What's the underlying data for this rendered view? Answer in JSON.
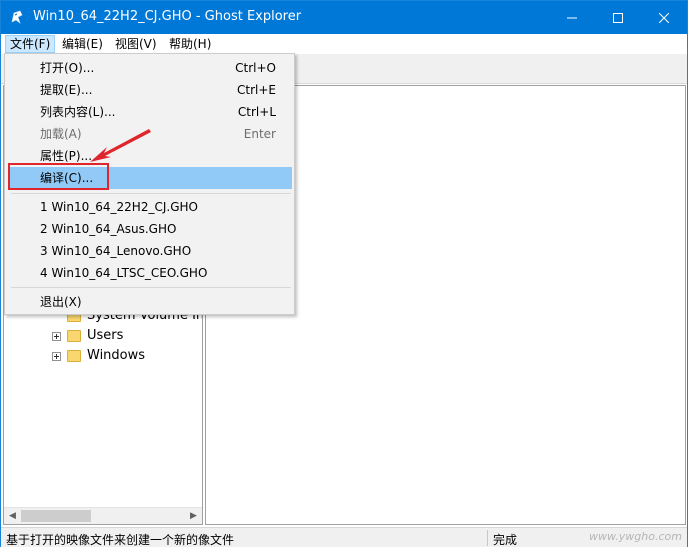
{
  "window": {
    "title": "Win10_64_22H2_CJ.GHO - Ghost Explorer",
    "icon": "ghost-app-icon"
  },
  "menubar": {
    "items": [
      {
        "label": "文件(F)"
      },
      {
        "label": "编辑(E)"
      },
      {
        "label": "视图(V)"
      },
      {
        "label": "帮助(H)"
      }
    ]
  },
  "file_menu": {
    "items": [
      {
        "label": "打开(O)...",
        "shortcut": "Ctrl+O"
      },
      {
        "label": "提取(E)...",
        "shortcut": "Ctrl+E"
      },
      {
        "label": "列表内容(L)...",
        "shortcut": "Ctrl+L"
      },
      {
        "label": "加载(A)",
        "shortcut": "Enter",
        "disabled": true
      },
      {
        "label": "属性(P)...",
        "shortcut": ""
      },
      {
        "label": "编译(C)...",
        "shortcut": "",
        "highlighted": true
      }
    ],
    "recent": [
      {
        "label": "1 Win10_64_22H2_CJ.GHO"
      },
      {
        "label": "2 Win10_64_Asus.GHO"
      },
      {
        "label": "3 Win10_64_Lenovo.GHO"
      },
      {
        "label": "4 Win10_64_LTSC_CEO.GHO"
      }
    ],
    "exit": {
      "label": "退出(X)"
    }
  },
  "tree": {
    "items": [
      {
        "label": "System Volume Information",
        "partial": true
      },
      {
        "label": "Users"
      },
      {
        "label": "Windows"
      }
    ]
  },
  "statusbar": {
    "message": "基于打开的映像文件来创建一个新的像文件",
    "state": "完成",
    "watermark": "www.ywgho.com"
  },
  "colors": {
    "titlebar": "#0078d7",
    "menu_highlight": "#91c9f7",
    "annotation_red": "#e0262d"
  }
}
